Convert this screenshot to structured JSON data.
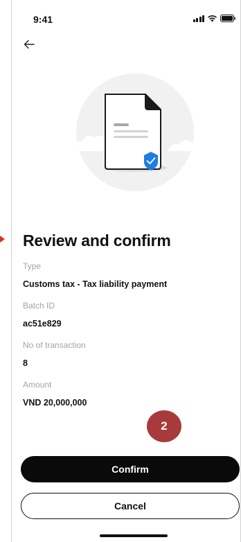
{
  "status_bar": {
    "time": "9:41",
    "icons": [
      "signal-icon",
      "wifi-icon",
      "battery-icon"
    ]
  },
  "header": {
    "back_icon": "arrow-left-icon"
  },
  "illustration": {
    "icon": "document-verified-icon",
    "accent_color": "#1f7ce0"
  },
  "page": {
    "title": "Review and confirm"
  },
  "details": [
    {
      "label": "Type",
      "value": "Customs tax - Tax liability payment"
    },
    {
      "label": "Batch ID",
      "value": "ac51e829"
    },
    {
      "label": "No of transaction",
      "value": "8"
    },
    {
      "label": "Amount",
      "value": "VND 20,000,000"
    }
  ],
  "annotation": {
    "step_number": "2",
    "color": "#a83a3b"
  },
  "actions": {
    "confirm_label": "Confirm",
    "cancel_label": "Cancel"
  }
}
